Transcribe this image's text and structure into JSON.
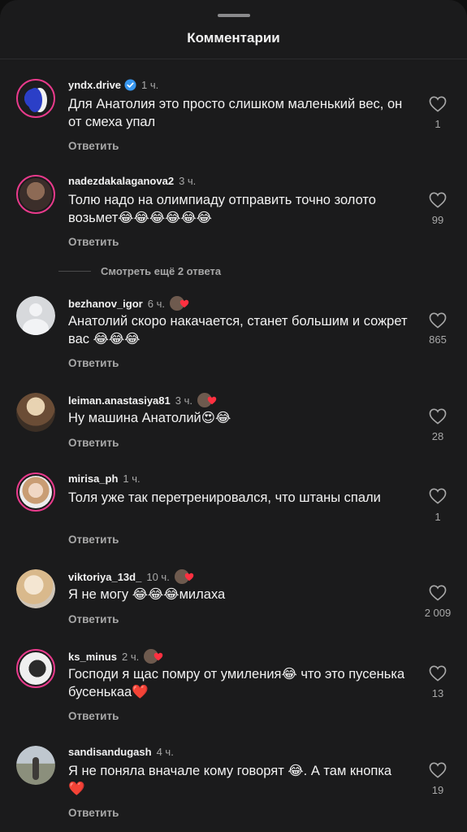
{
  "header": {
    "title": "Комментарии"
  },
  "more_replies": "Смотреть ещё 2 ответа",
  "reply_label": "Ответить",
  "comments": [
    {
      "user": "yndx.drive",
      "verified": true,
      "time": "1 ч.",
      "creator_liked": false,
      "text": "Для Анатолия это просто слишком маленький вес, он от смеха упал",
      "likes": "1"
    },
    {
      "user": "nadezdakalaganova2",
      "time": "3 ч.",
      "creator_liked": false,
      "text": "Толю надо на олимпиаду отправить точно золото возьмет😂😂😂😂😂😂",
      "likes": "99"
    },
    {
      "user": "bezhanov_igor",
      "time": "6 ч.",
      "creator_liked": true,
      "text": "Анатолий  скоро накачается, станет большим и сожрет вас 😂😂😂",
      "likes": "865"
    },
    {
      "user": "leiman.anastasiya81",
      "time": "3 ч.",
      "creator_liked": true,
      "text": "Ну машина Анатолий😍😂",
      "likes": "28"
    },
    {
      "user": "mirisa_ph",
      "time": "1 ч.",
      "creator_liked": false,
      "text": "Толя уже так перетренировался, что штаны спали",
      "likes": "1"
    },
    {
      "user": "viktoriya_13d_",
      "time": "10 ч.",
      "creator_liked": true,
      "text": "Я не могу 😂😂😂милаха",
      "likes": "2 009"
    },
    {
      "user": "ks_minus",
      "time": "2 ч.",
      "creator_liked": true,
      "text": "Господи я щас помру от умиления😂 что это пусенька бусенькаа❤️",
      "likes": "13"
    },
    {
      "user": "sandisandugash",
      "time": "4 ч.",
      "creator_liked": false,
      "text": "Я не поняла вначале кому говорят 😂. А там кнопка ❤️",
      "likes": "19"
    }
  ],
  "colors": {
    "background": "#1b1b1c",
    "accent_heart": "#e0245e",
    "verified": "#3897f0",
    "story_ring": "#e83a8b"
  }
}
